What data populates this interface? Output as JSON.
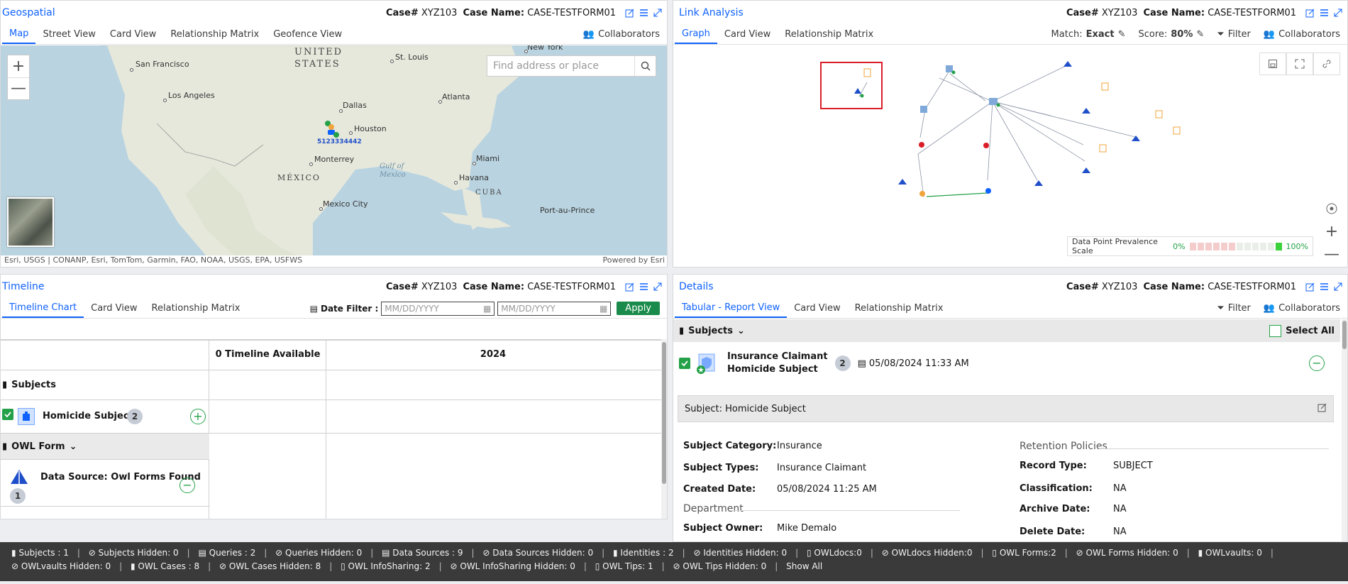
{
  "case": {
    "case_label": "Case#",
    "case_num": "XYZ103",
    "name_label": "Case Name:",
    "name_val": "CASE-TESTFORM01"
  },
  "geo": {
    "title": "Geospatial",
    "tabs": [
      "Map",
      "Street View",
      "Card View",
      "Relationship Matrix",
      "Geofence View"
    ],
    "collab": "Collaborators",
    "search_placeholder": "Find address or place",
    "attribution": "Esri, USGS | CONANP, Esri, TomTom, Garmin, FAO, NOAA, USGS, EPA, USFWS",
    "powered": "Powered by Esri",
    "zoom_in": "+",
    "zoom_out": "—",
    "marker_label": "5123334442",
    "labels": {
      "united": "UNITED",
      "states": "STATES",
      "mexico": "MÉXICO",
      "cuba": "CUBA",
      "gulf": "Gulf of",
      "gulf2": "Mexico",
      "ny": "New York",
      "sf": "San Francisco",
      "la": "Los Angeles",
      "stl": "St. Louis",
      "atl": "Atlanta",
      "dal": "Dallas",
      "hou": "Houston",
      "mon": "Monterrey",
      "mia": "Miami",
      "hav": "Havana",
      "mxc": "Mexico City",
      "pap": "Port-au-Prince"
    }
  },
  "link": {
    "title": "Link Analysis",
    "tabs": [
      "Graph",
      "Card View",
      "Relationship Matrix"
    ],
    "match_label": "Match:",
    "match_val": "Exact",
    "score_label": "Score:",
    "score_val": "80%",
    "filter": "Filter",
    "collab": "Collaborators",
    "prev_label": "Data Point Prevalence Scale",
    "prev_min": "0%",
    "prev_max": "100%",
    "zoom_in": "+",
    "zoom_out": "—"
  },
  "timeline": {
    "title": "Timeline",
    "tabs": [
      "Timeline Chart",
      "Card View",
      "Relationship Matrix"
    ],
    "date_filter": "Date Filter :",
    "date_placeholder": "MM/DD/YYYY",
    "apply": "Apply",
    "col_available": "0 Timeline Available",
    "col_year": "2024",
    "subjects": "Subjects",
    "subject_name": "Homicide Subject",
    "subject_count": "2",
    "owl_form": "OWL Form",
    "ds_name": "Data Source: Owl Forms Found",
    "ds_count": "1"
  },
  "details": {
    "title": "Details",
    "tabs": [
      "Tabular - Report View",
      "Card View",
      "Relationship Matrix"
    ],
    "filter": "Filter",
    "collab": "Collaborators",
    "subjects": "Subjects",
    "select_all": "Select All",
    "item_line1": "Insurance Claimant",
    "item_line2": "Homicide Subject",
    "item_count": "2",
    "item_date": "05/08/2024 11:33 AM",
    "subj_header": "Subject: Homicide Subject",
    "f_category_k": "Subject Category:",
    "f_category_v": "Insurance",
    "f_types_k": "Subject Types:",
    "f_types_v": "Insurance Claimant",
    "f_created_k": "Created Date:",
    "f_created_v": "05/08/2024 11:25 AM",
    "dept": "Department",
    "f_owner_k": "Subject Owner:",
    "f_owner_v": "Mike Demalo",
    "retention": "Retention Policies",
    "f_rec_k": "Record Type:",
    "f_rec_v": "SUBJECT",
    "f_class_k": "Classification:",
    "f_class_v": "NA",
    "f_arch_k": "Archive Date:",
    "f_arch_v": "NA",
    "f_del_k": "Delete Date:",
    "f_del_v": "NA"
  },
  "status": {
    "row1": [
      "Subjects : 1",
      "Subjects Hidden: 0",
      "Queries : 2",
      "Queries Hidden: 0",
      "Data Sources : 9",
      "Data Sources Hidden: 0",
      "Identities : 2",
      "Identities Hidden: 0",
      "OWLdocs:0",
      "OWLdocs Hidden:0",
      "OWL Forms:2",
      "OWL Forms Hidden: 0",
      "OWLvaults: 0"
    ],
    "row2": [
      "OWLvaults Hidden: 0",
      "OWL Cases : 8",
      "OWL Cases Hidden: 8",
      "OWL InfoSharing: 2",
      "OWL InfoSharing Hidden: 0",
      "OWL Tips: 1",
      "OWL Tips Hidden: 0",
      "Show All"
    ]
  }
}
